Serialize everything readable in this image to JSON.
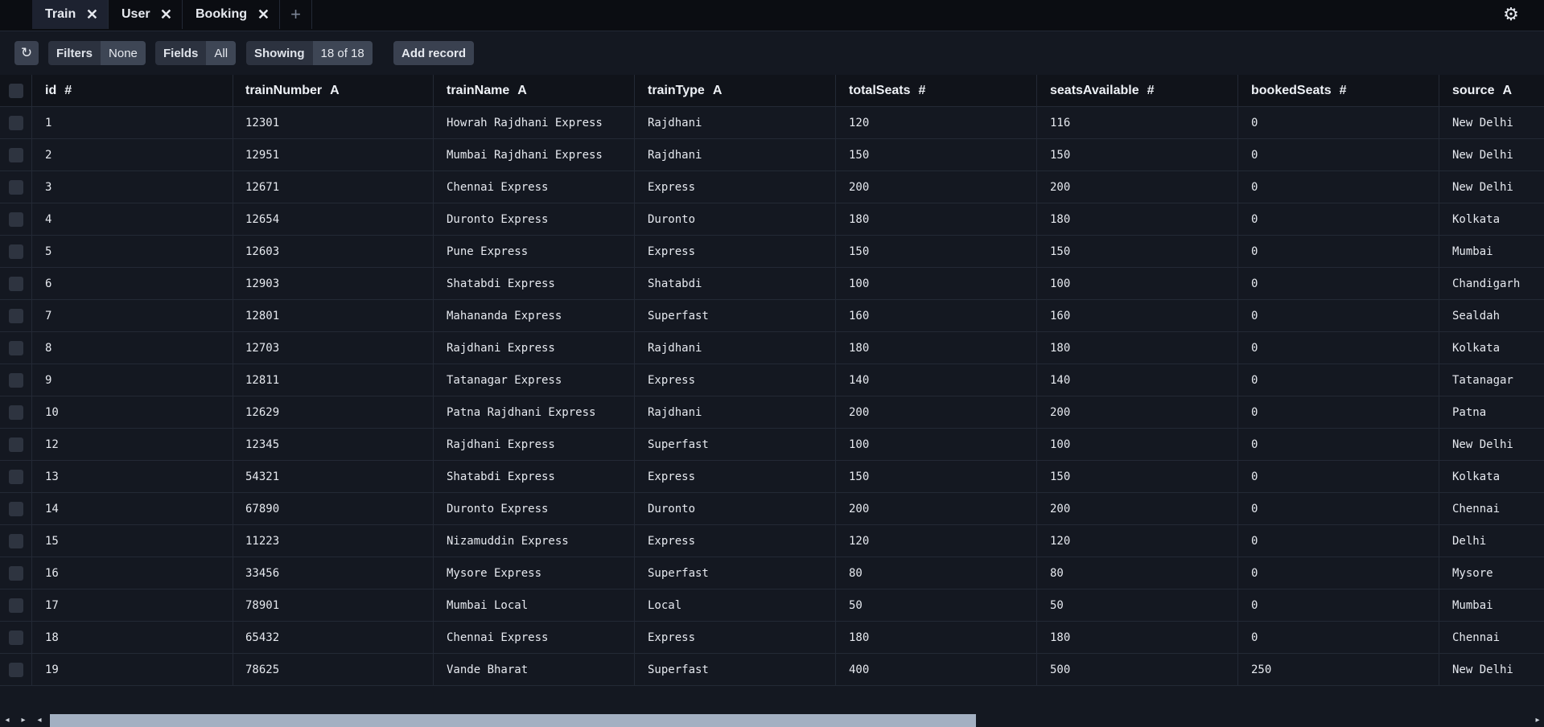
{
  "tabs": [
    {
      "label": "Train",
      "close": "✕"
    },
    {
      "label": "User",
      "close": "✕"
    },
    {
      "label": "Booking",
      "close": "✕"
    }
  ],
  "tab_add": "+",
  "settings_icon": "⚙",
  "toolbar": {
    "refresh_icon": "↻",
    "filters_label": "Filters",
    "filters_value": "None",
    "fields_label": "Fields",
    "fields_value": "All",
    "showing_label": "Showing",
    "showing_value": "18 of 18",
    "add_record": "Add record"
  },
  "columns": [
    {
      "name": "id",
      "type": "#"
    },
    {
      "name": "trainNumber",
      "type": "A"
    },
    {
      "name": "trainName",
      "type": "A"
    },
    {
      "name": "trainType",
      "type": "A"
    },
    {
      "name": "totalSeats",
      "type": "#"
    },
    {
      "name": "seatsAvailable",
      "type": "#"
    },
    {
      "name": "bookedSeats",
      "type": "#"
    },
    {
      "name": "source",
      "type": "A"
    }
  ],
  "rows": [
    [
      "1",
      "12301",
      "Howrah Rajdhani Express",
      "Rajdhani",
      "120",
      "116",
      "0",
      "New Delhi"
    ],
    [
      "2",
      "12951",
      "Mumbai Rajdhani Express",
      "Rajdhani",
      "150",
      "150",
      "0",
      "New Delhi"
    ],
    [
      "3",
      "12671",
      "Chennai Express",
      "Express",
      "200",
      "200",
      "0",
      "New Delhi"
    ],
    [
      "4",
      "12654",
      "Duronto Express",
      "Duronto",
      "180",
      "180",
      "0",
      "Kolkata"
    ],
    [
      "5",
      "12603",
      "Pune Express",
      "Express",
      "150",
      "150",
      "0",
      "Mumbai"
    ],
    [
      "6",
      "12903",
      "Shatabdi Express",
      "Shatabdi",
      "100",
      "100",
      "0",
      "Chandigarh"
    ],
    [
      "7",
      "12801",
      "Mahananda Express",
      "Superfast",
      "160",
      "160",
      "0",
      "Sealdah"
    ],
    [
      "8",
      "12703",
      "Rajdhani Express",
      "Rajdhani",
      "180",
      "180",
      "0",
      "Kolkata"
    ],
    [
      "9",
      "12811",
      "Tatanagar Express",
      "Express",
      "140",
      "140",
      "0",
      "Tatanagar"
    ],
    [
      "10",
      "12629",
      "Patna Rajdhani Express",
      "Rajdhani",
      "200",
      "200",
      "0",
      "Patna"
    ],
    [
      "12",
      "12345",
      "Rajdhani Express",
      "Superfast",
      "100",
      "100",
      "0",
      "New Delhi"
    ],
    [
      "13",
      "54321",
      "Shatabdi Express",
      "Express",
      "150",
      "150",
      "0",
      "Kolkata"
    ],
    [
      "14",
      "67890",
      "Duronto Express",
      "Duronto",
      "200",
      "200",
      "0",
      "Chennai"
    ],
    [
      "15",
      "11223",
      "Nizamuddin Express",
      "Express",
      "120",
      "120",
      "0",
      "Delhi"
    ],
    [
      "16",
      "33456",
      "Mysore Express",
      "Superfast",
      "80",
      "80",
      "0",
      "Mysore"
    ],
    [
      "17",
      "78901",
      "Mumbai Local",
      "Local",
      "50",
      "50",
      "0",
      "Mumbai"
    ],
    [
      "18",
      "65432",
      "Chennai Express",
      "Express",
      "180",
      "180",
      "0",
      "Chennai"
    ],
    [
      "19",
      "78625",
      "Vande Bharat",
      "Superfast",
      "400",
      "500",
      "250",
      "New Delhi"
    ]
  ],
  "scrollbar": {
    "left_arrow": "◂",
    "right_arrow": "▸",
    "start_arrow": "◂",
    "end_arrow": "▸"
  }
}
